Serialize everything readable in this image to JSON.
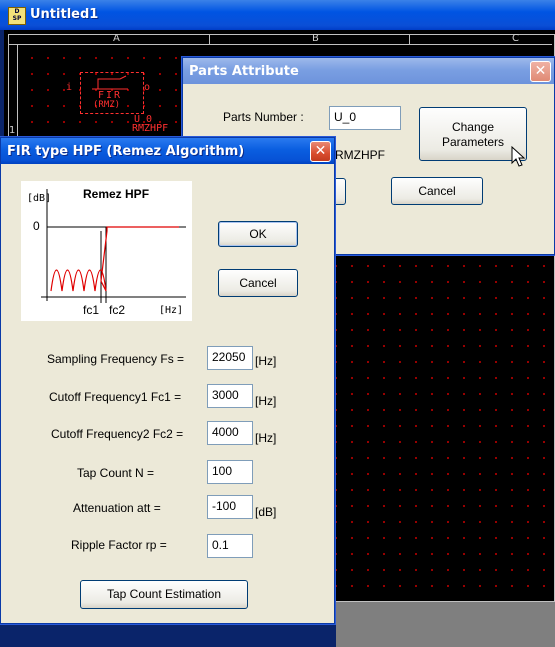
{
  "main_window": {
    "title": "Untitled1",
    "icon_text": [
      "D",
      "SP"
    ],
    "ruler_columns": [
      "A",
      "B",
      "C"
    ],
    "ruler_row": "1"
  },
  "part_symbol": {
    "pin_in": "i",
    "pin_out": "o",
    "filter_label": "FIR",
    "sub_label": "(RMZ)",
    "ref": "U_0",
    "type": "RMZHPF"
  },
  "parts_attribute": {
    "title": "Parts Attribute",
    "parts_number_label": "Parts Number :",
    "parts_number_value": "U_0",
    "change_parameters_line1": "Change",
    "change_parameters_line2": "Parameters",
    "part_type": "RMZHPF",
    "cancel_label": "Cancel"
  },
  "fir_dialog": {
    "title": "FIR type HPF (Remez Algorithm)",
    "close_label": "✕",
    "graph": {
      "title": "Remez HPF",
      "y_unit": "[dB]",
      "y_zero": "0",
      "x_tick1": "fc1",
      "x_tick2": "fc2",
      "x_unit": "[Hz]"
    },
    "ok_label": "OK",
    "cancel_label": "Cancel",
    "fields": [
      {
        "label": "Sampling Frequency Fs =",
        "value": "22050",
        "unit": "[Hz]"
      },
      {
        "label": "Cutoff Frequency1 Fc1 =",
        "value": "3000",
        "unit": "[Hz]"
      },
      {
        "label": "Cutoff Frequency2 Fc2 =",
        "value": "4000",
        "unit": "[Hz]"
      },
      {
        "label": "Tap Count N =",
        "value": "100",
        "unit": ""
      },
      {
        "label": "Attenuation att =",
        "value": "-100",
        "unit": "[dB]"
      },
      {
        "label": "Ripple Factor rp =",
        "value": "0.1",
        "unit": ""
      }
    ],
    "tap_estimation_label": "Tap Count Estimation"
  },
  "colors": {
    "titlebar": "#0054e3",
    "dialog_bg": "#ece9d8",
    "close_red": "#d94d2f",
    "plot_red": "#e00000",
    "schematic_bg": "#000000",
    "grid_dot": "#a30000"
  }
}
